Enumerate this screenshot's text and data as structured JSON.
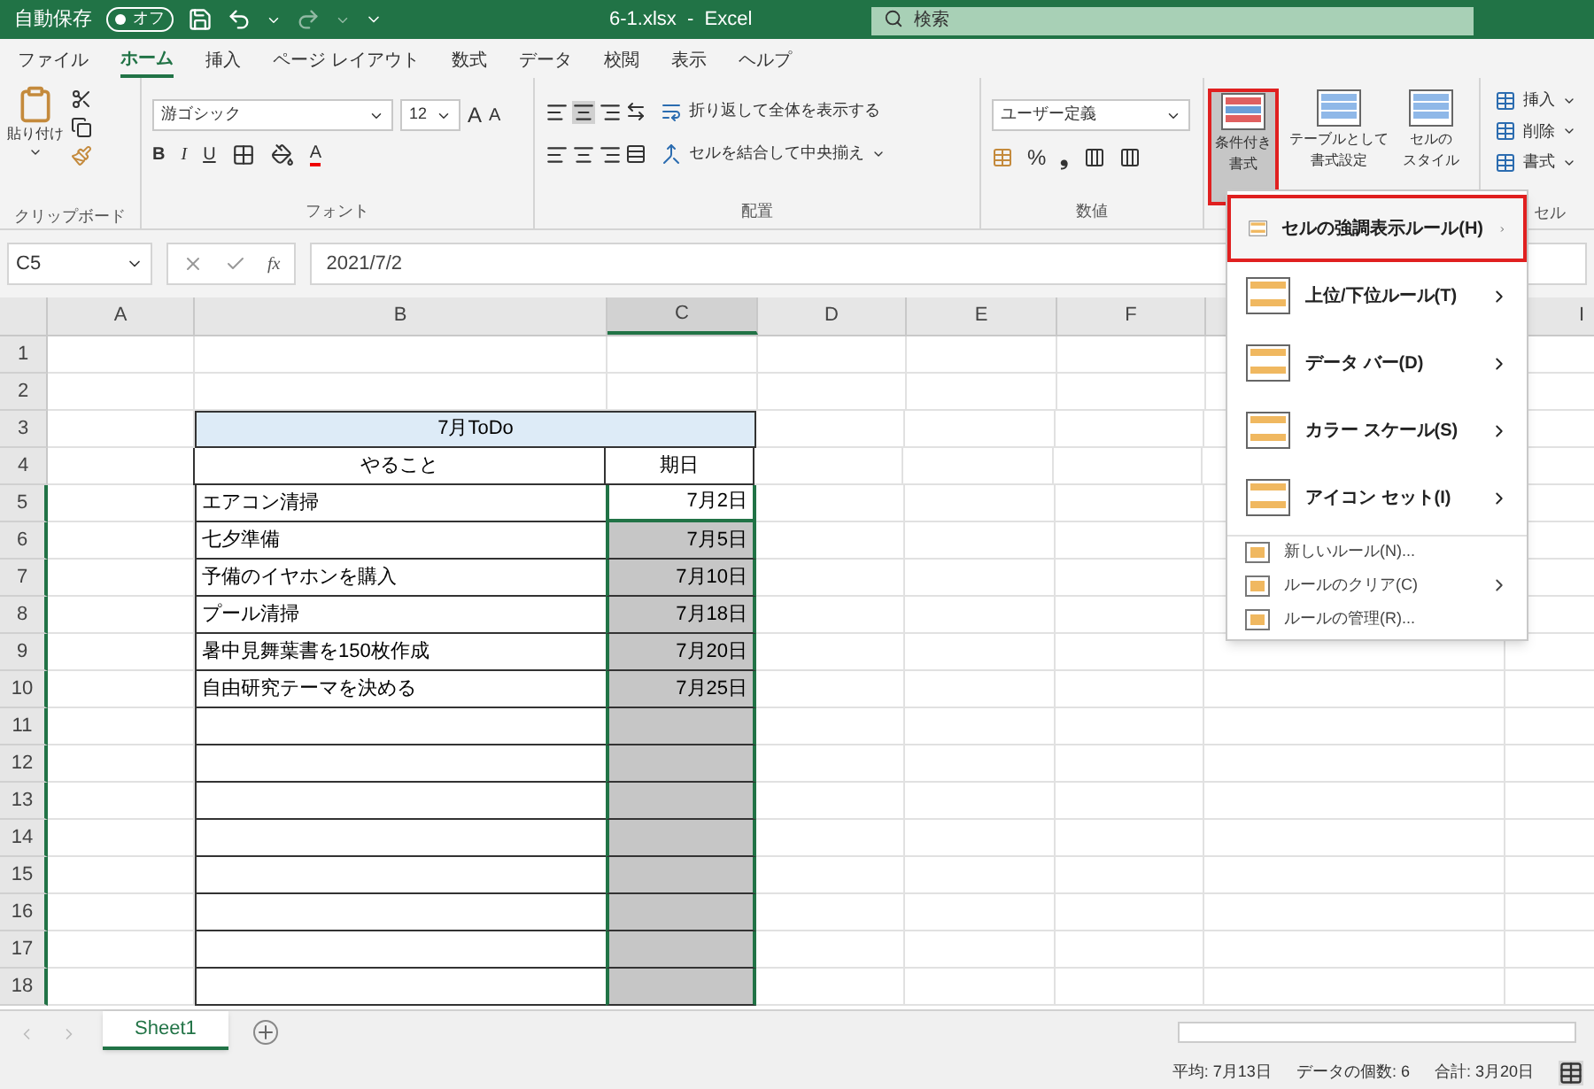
{
  "title_bar": {
    "autosave_label": "自動保存",
    "autosave": {
      "on": false,
      "label": "オフ"
    },
    "title": "6-1.xlsx  -  Excel",
    "search": {
      "placeholder": "検索"
    }
  },
  "tabs": [
    {
      "label": "ファイル",
      "selected": false
    },
    {
      "label": "ホーム",
      "selected": true
    },
    {
      "label": "挿入",
      "selected": false
    },
    {
      "label": "ページ レイアウト",
      "selected": false
    },
    {
      "label": "数式",
      "selected": false
    },
    {
      "label": "データ",
      "selected": false
    },
    {
      "label": "校閲",
      "selected": false
    },
    {
      "label": "表示",
      "selected": false
    },
    {
      "label": "ヘルプ",
      "selected": false
    }
  ],
  "ribbon": {
    "clipboard": {
      "paste": "貼り付け",
      "label": "クリップボード"
    },
    "font": {
      "name": "游ゴシック",
      "size": "12",
      "grow": "A",
      "shrink": "A",
      "bold": "B",
      "italic": "I",
      "underline": "U",
      "font_color_letter": "A",
      "label": "フォント"
    },
    "alignment": {
      "wrap": "折り返して全体を表示する",
      "merge": "セルを結合して中央揃え",
      "label": "配置"
    },
    "number": {
      "format": "ユーザー定義",
      "percent": "%",
      "comma": "❟",
      "label": "数値"
    },
    "styles": [
      {
        "lines": [
          "条件付き",
          "書式"
        ],
        "selected": true
      },
      {
        "lines": [
          "テーブルとして",
          "書式設定"
        ],
        "selected": false
      },
      {
        "lines": [
          "セルの",
          "スタイル"
        ],
        "selected": false
      }
    ],
    "cells": {
      "items": [
        "挿入",
        "削除",
        "書式"
      ],
      "label": "セル"
    }
  },
  "formula_bar": {
    "name_box": "C5",
    "function_symbol": "fx",
    "formula": "2021/7/2"
  },
  "sheet": {
    "columns": [
      {
        "label": "A",
        "selected": false
      },
      {
        "label": "B",
        "selected": false
      },
      {
        "label": "C",
        "selected": true
      },
      {
        "label": "D",
        "selected": false
      },
      {
        "label": "E",
        "selected": false
      },
      {
        "label": "F",
        "selected": false
      },
      {
        "label": "I",
        "selected": false
      }
    ],
    "rows": [
      {
        "label": "1",
        "selected": false
      },
      {
        "label": "2",
        "selected": false
      },
      {
        "label": "3",
        "selected": false
      },
      {
        "label": "4",
        "selected": false
      },
      {
        "label": "5",
        "selected": true
      },
      {
        "label": "6",
        "selected": true
      },
      {
        "label": "7",
        "selected": true
      },
      {
        "label": "8",
        "selected": true
      },
      {
        "label": "9",
        "selected": true
      },
      {
        "label": "10",
        "selected": true
      },
      {
        "label": "11",
        "selected": true
      },
      {
        "label": "12",
        "selected": true
      },
      {
        "label": "13",
        "selected": true
      },
      {
        "label": "14",
        "selected": true
      },
      {
        "label": "15",
        "selected": true
      },
      {
        "label": "16",
        "selected": true
      },
      {
        "label": "17",
        "selected": true
      },
      {
        "label": "18",
        "selected": true
      }
    ],
    "todo": {
      "title": "7月ToDo",
      "headers": [
        "やること",
        "期日"
      ],
      "tasks": [
        {
          "task": "エアコン清掃",
          "due": "7月2日",
          "active": true
        },
        {
          "task": "七夕準備",
          "due": "7月5日",
          "selected": true
        },
        {
          "task": "予備のイヤホンを購入",
          "due": "7月10日",
          "selected": true
        },
        {
          "task": "プール清掃",
          "due": "7月18日",
          "selected": true
        },
        {
          "task": "暑中見舞葉書を150枚作成",
          "due": "7月20日",
          "selected": true
        },
        {
          "task": "自由研究テーマを決める",
          "due": "7月25日",
          "selected": true
        }
      ],
      "blank_rows": [
        {
          "selected": true
        },
        {
          "selected": true
        },
        {
          "selected": true
        },
        {
          "selected": true
        },
        {
          "selected": true
        },
        {
          "selected": true
        },
        {
          "selected": true
        },
        {
          "selected": true
        }
      ]
    }
  },
  "menu": [
    {
      "kind": "large",
      "label": "セルの強調表示ルール(H)",
      "selected": true,
      "submenu": true
    },
    {
      "kind": "large",
      "label": "上位/下位ルール(T)",
      "selected": false,
      "submenu": true
    },
    {
      "kind": "large",
      "label": "データ バー(D)",
      "selected": false,
      "submenu": true
    },
    {
      "kind": "large",
      "label": "カラー スケール(S)",
      "selected": false,
      "submenu": true
    },
    {
      "kind": "large",
      "label": "アイコン セット(I)",
      "selected": false,
      "submenu": true
    },
    {
      "kind": "small",
      "label": "新しいルール(N)...",
      "selected": false,
      "submenu": false
    },
    {
      "kind": "small",
      "label": "ルールのクリア(C)",
      "selected": false,
      "submenu": true
    },
    {
      "kind": "small",
      "label": "ルールの管理(R)...",
      "selected": false,
      "submenu": false
    }
  ],
  "sheet_tabs": [
    {
      "label": "Sheet1",
      "selected": true
    }
  ],
  "status_bar": [
    "平均: 7月13日",
    "データの個数: 6",
    "合計: 3月20日"
  ]
}
